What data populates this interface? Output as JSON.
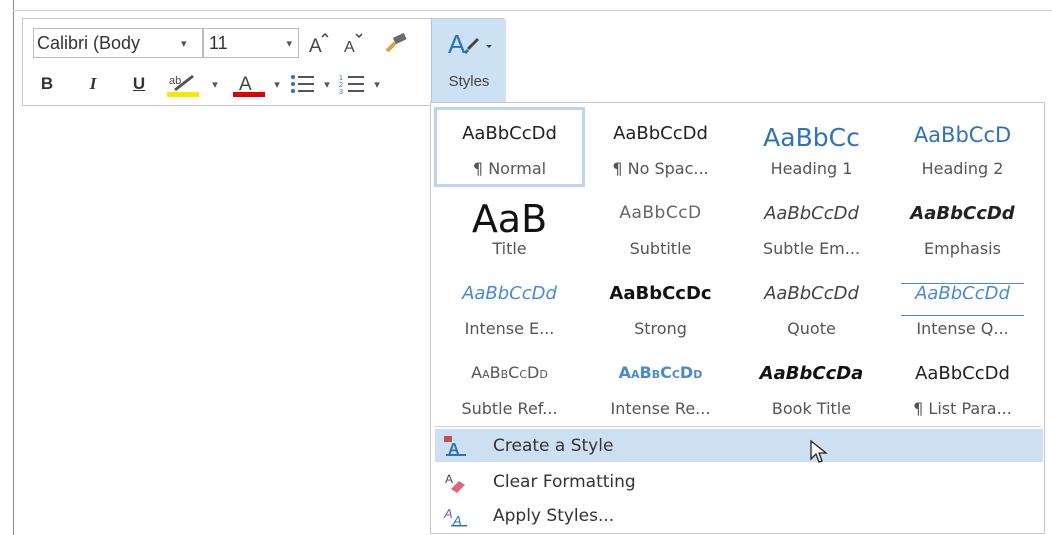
{
  "toolbar": {
    "font_name": "Calibri (Body",
    "font_size": "11",
    "styles_label": "Styles",
    "highlight_color": "#f5e900",
    "font_color": "#e00000"
  },
  "gallery": {
    "styles": [
      {
        "sample": "AaBbCcDd",
        "name": "¶ Normal"
      },
      {
        "sample": "AaBbCcDd",
        "name": "¶ No Spac..."
      },
      {
        "sample": "AaBbCc",
        "name": "Heading 1"
      },
      {
        "sample": "AaBbCcD",
        "name": "Heading 2"
      },
      {
        "sample": "AaB",
        "name": "Title"
      },
      {
        "sample": "AaBbCcD",
        "name": "Subtitle"
      },
      {
        "sample": "AaBbCcDd",
        "name": "Subtle Em..."
      },
      {
        "sample": "AaBbCcDd",
        "name": "Emphasis"
      },
      {
        "sample": "AaBbCcDd",
        "name": "Intense E..."
      },
      {
        "sample": "AaBbCcDc",
        "name": "Strong"
      },
      {
        "sample": "AaBbCcDd",
        "name": "Quote"
      },
      {
        "sample": "AaBbCcDd",
        "name": "Intense Q..."
      },
      {
        "sample": "AaBbCcDd",
        "name": "Subtle Ref..."
      },
      {
        "sample": "AaBbCcDd",
        "name": "Intense Re..."
      },
      {
        "sample": "AaBbCcDa",
        "name": "Book Title"
      },
      {
        "sample": "AaBbCcDd",
        "name": "¶ List Para..."
      }
    ],
    "menu": {
      "create_style": "Create a Style",
      "clear_formatting": "Clear Formatting",
      "apply_styles": "Apply Styles..."
    },
    "accent_color": "#2e74b5"
  }
}
